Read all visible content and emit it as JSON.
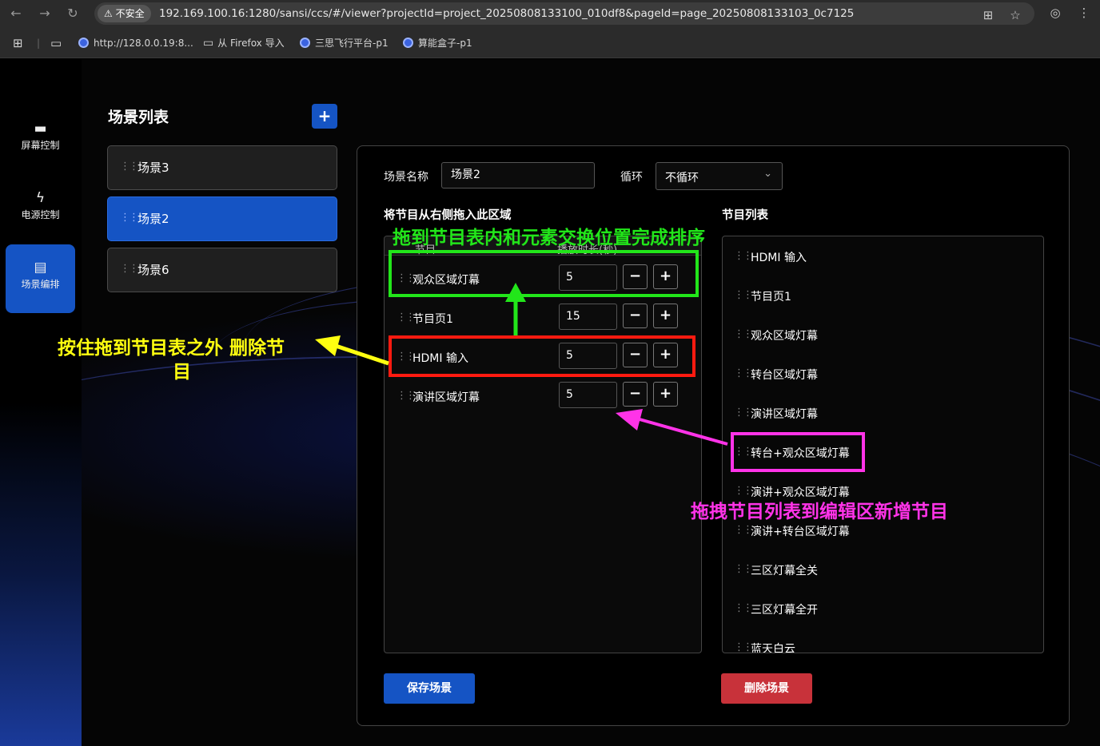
{
  "browser": {
    "security_label": "不安全",
    "url": "192.169.100.16:1280/sansi/ccs/#/viewer?projectId=project_20250808133100_010df8&pageId=page_20250808133103_0c7125",
    "bookmarks": [
      "http://128.0.0.19:8...",
      "从 Firefox 导入",
      "三思飞行平台-p1",
      "算能盒子-p1"
    ]
  },
  "sidebar": {
    "items": [
      {
        "label": "屏幕控制",
        "icon": "monitor-icon",
        "active": false
      },
      {
        "label": "电源控制",
        "icon": "lightning-icon",
        "active": false
      },
      {
        "label": "场景编排",
        "icon": "clapperboard-icon",
        "active": true
      }
    ]
  },
  "scenes": {
    "title": "场景列表",
    "add_label": "+",
    "items": [
      {
        "label": "场景3",
        "active": false
      },
      {
        "label": "场景2",
        "active": true
      },
      {
        "label": "场景6",
        "active": false
      }
    ]
  },
  "editor": {
    "name_label": "场景名称",
    "name_value": "场景2",
    "loop_label": "循环",
    "loop_value": "不循环",
    "drop_heading": "将节目从右侧拖入此区域",
    "col_program": "节目",
    "col_duration": "播放时长(秒)",
    "rows": [
      {
        "label": "观众区域灯幕",
        "duration": "5"
      },
      {
        "label": "节目页1",
        "duration": "15"
      },
      {
        "label": "HDMI 输入",
        "duration": "5"
      },
      {
        "label": "演讲区域灯幕",
        "duration": "5"
      }
    ],
    "minus_label": "−",
    "plus_label": "+",
    "list_heading": "节目列表",
    "programs": [
      "HDMI 输入",
      "节目页1",
      "观众区域灯幕",
      "转台区域灯幕",
      "演讲区域灯幕",
      "转台+观众区域灯幕",
      "演讲+观众区域灯幕",
      "演讲+转台区域灯幕",
      "三区灯幕全关",
      "三区灯幕全开",
      "蓝天白云"
    ],
    "save_label": "保存场景",
    "delete_label": "删除场景"
  },
  "annotations": {
    "sort_hint": "拖到节目表内和元素交换位置完成排序",
    "delete_hint_line1": "按住拖到节目表之外 删除节",
    "delete_hint_line2": "目",
    "add_hint": "拖拽节目列表到编辑区新增节目"
  },
  "colors": {
    "accent": "#1554c4",
    "danger": "#c8323a",
    "annotation_green": "#22e61a",
    "annotation_yellow": "#ffff10",
    "annotation_magenta": "#ff33e8",
    "annotation_red": "#ff1a10"
  }
}
